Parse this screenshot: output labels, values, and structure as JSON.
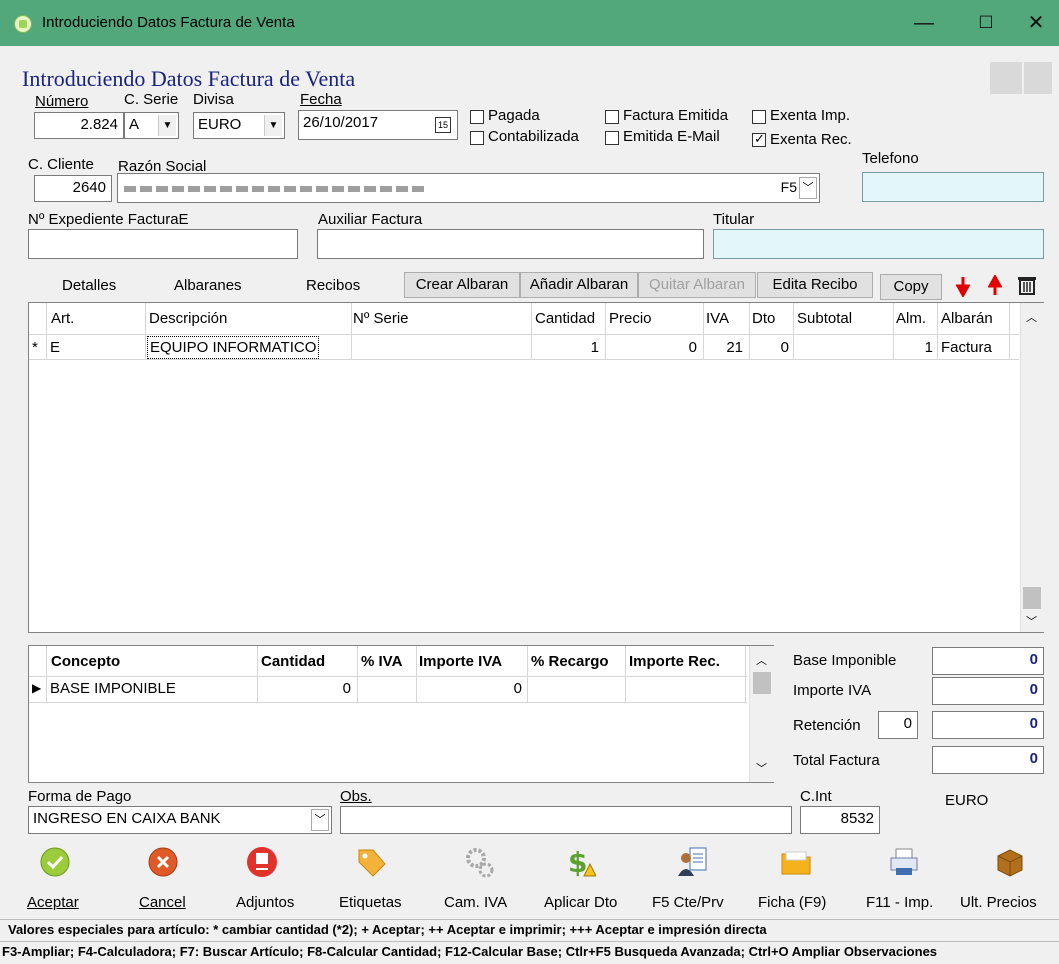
{
  "window": {
    "title": "Introduciendo Datos Factura de Venta",
    "min": "—",
    "max": "☐",
    "close": "✕"
  },
  "form": {
    "header": "Introduciendo Datos Factura de Venta",
    "numero_label": "Número",
    "numero": "2.824",
    "serie_label": "C. Serie",
    "serie": "A",
    "divisa_label": "Divisa",
    "divisa": "EURO",
    "fecha_label": "Fecha",
    "fecha": "26/10/2017",
    "checks": {
      "pagada": "Pagada",
      "contabilizada": "Contabilizada",
      "factura_emitida": "Factura Emitida",
      "emitida_email": "Emitida E-Mail",
      "exenta_imp": "Exenta Imp.",
      "exenta_rec": "Exenta Rec."
    },
    "telefono_label": "Telefono",
    "cliente_label": "C. Cliente",
    "cliente": "2640",
    "razon_label": "Razón Social",
    "razon_f5": "F5",
    "expediente_label": "Nº Expediente FacturaE",
    "auxiliar_label": "Auxiliar Factura",
    "titular_label": "Titular"
  },
  "tabs": [
    "Detalles",
    "Albaranes",
    "Recibos"
  ],
  "actions": {
    "crear": "Crear Albaran",
    "anadir": "Añadir Albaran",
    "quitar": "Quitar Albaran",
    "edita": "Edita Recibo",
    "copy": "Copy"
  },
  "lines": {
    "headers": [
      "Art.",
      "Descripción",
      "Nº Serie",
      "Cantidad",
      "Precio",
      "IVA",
      "Dto",
      "Subtotal",
      "Alm.",
      "Albarán"
    ],
    "rows": [
      {
        "marker": "*",
        "art": "E",
        "desc": "EQUIPO INFORMATICO",
        "serie": "",
        "cantidad": "1",
        "precio": "0",
        "iva": "21",
        "dto": "0",
        "subtotal": "",
        "alm": "1",
        "albaran": "Factura"
      }
    ]
  },
  "taxes": {
    "headers": [
      "Concepto",
      "Cantidad",
      "% IVA",
      "Importe IVA",
      "% Recargo",
      "Importe Rec."
    ],
    "rows": [
      {
        "marker": "▶",
        "concepto": "BASE IMPONIBLE",
        "cantidad": "0",
        "iva": "",
        "importe_iva": "0",
        "recargo": "",
        "importe_rec": ""
      }
    ]
  },
  "totals": {
    "base_label": "Base Imponible",
    "base": "0",
    "iva_label": "Importe IVA",
    "iva": "0",
    "ret_label": "Retención",
    "ret_pct": "0",
    "ret": "0",
    "total_label": "Total Factura",
    "total": "0"
  },
  "pago": {
    "label": "Forma de Pago",
    "value": "INGRESO EN CAIXA BANK",
    "obs_label": "Obs.",
    "cint_label": "C.Int",
    "cint": "8532",
    "currency": "EURO"
  },
  "toolbar": [
    {
      "label": "Aceptar",
      "icon": "check-circle-icon"
    },
    {
      "label": "Cancel",
      "icon": "cancel-circle-icon"
    },
    {
      "label": "Adjuntos",
      "icon": "pdf-icon"
    },
    {
      "label": "Etiquetas",
      "icon": "tag-icon"
    },
    {
      "label": "Cam. IVA",
      "icon": "gears-icon"
    },
    {
      "label": "Aplicar Dto",
      "icon": "dollar-warning-icon"
    },
    {
      "label": "F5 Cte/Prv",
      "icon": "contact-card-icon"
    },
    {
      "label": "Ficha (F9)",
      "icon": "folder-icon"
    },
    {
      "label": "F11 - Imp.",
      "icon": "printer-icon"
    },
    {
      "label": "Ult. Precios",
      "icon": "box-icon"
    }
  ],
  "footer": {
    "line1": "Valores especiales para artículo: * cambiar cantidad (*2); + Aceptar; ++ Aceptar e imprimir; +++ Aceptar e impresión directa",
    "line2": "F3-Ampliar; F4-Calculadora; F7: Buscar Artículo; F8-Calcular Cantidad; F12-Calcular Base; Ctlr+F5 Busqueda Avanzada; Ctrl+O Ampliar Observaciones"
  },
  "colors": {
    "titlebar": "#52a87a",
    "header_text": "#1a237e",
    "cyan_field": "#e3f7fb",
    "arrow_red": "#e00000"
  }
}
